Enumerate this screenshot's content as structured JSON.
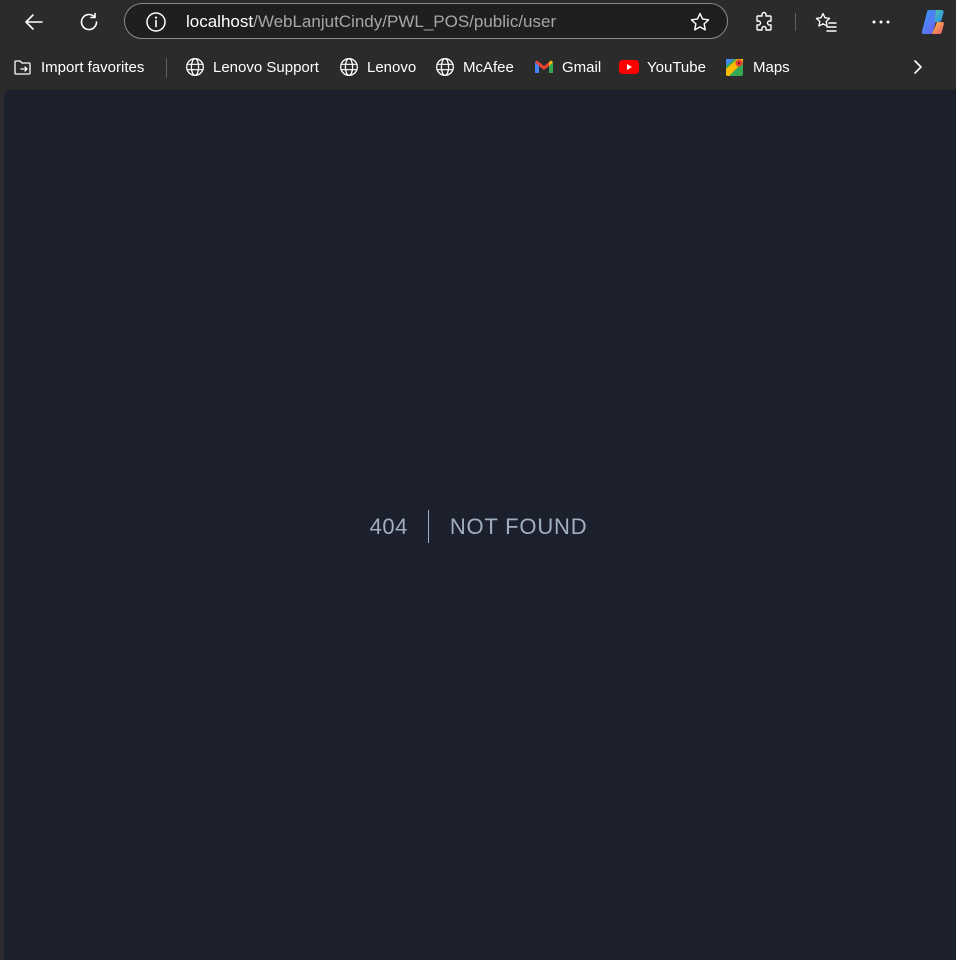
{
  "browser": {
    "url_host": "localhost",
    "url_path": "/WebLanjutCindy/PWL_POS/public/user",
    "icons": {
      "back": "back-arrow-icon",
      "refresh": "refresh-icon",
      "info": "info-icon",
      "favorite": "star-icon",
      "extensions": "puzzle-icon",
      "favorites_list": "favorites-icon",
      "menu": "more-icon",
      "copilot": "copilot-icon"
    }
  },
  "favorites": {
    "items": [
      {
        "label": "Import favorites",
        "icon": "import-icon"
      },
      {
        "label": "Lenovo Support",
        "icon": "globe-icon"
      },
      {
        "label": "Lenovo",
        "icon": "globe-icon"
      },
      {
        "label": "McAfee",
        "icon": "globe-icon"
      },
      {
        "label": "Gmail",
        "icon": "gmail-icon"
      },
      {
        "label": "YouTube",
        "icon": "youtube-icon"
      },
      {
        "label": "Maps",
        "icon": "maps-icon"
      }
    ]
  },
  "page": {
    "error_code": "404",
    "error_message": "Not Found"
  },
  "colors": {
    "chrome_bg": "#2b2b2b",
    "page_bg": "#1b202c",
    "error_text": "#a0aec0"
  }
}
